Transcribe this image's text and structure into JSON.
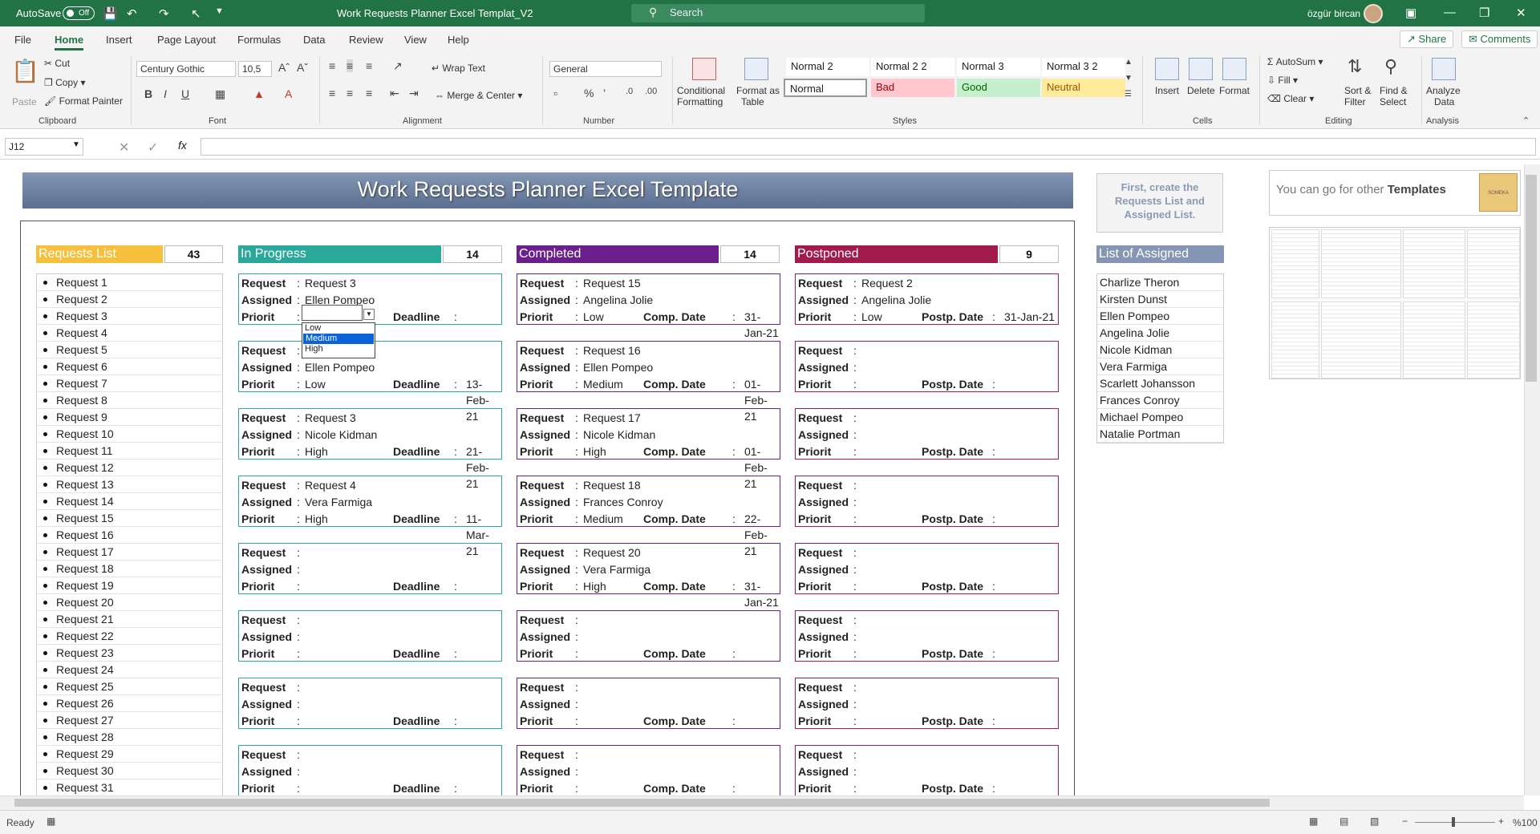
{
  "titlebar": {
    "autosave": "AutoSave",
    "autosave_state": "Off",
    "doc_title": "Work Requests Planner Excel Templat_V2",
    "search_placeholder": "Search",
    "user": "özgür bircan"
  },
  "tabs": [
    "File",
    "Home",
    "Insert",
    "Page Layout",
    "Formulas",
    "Data",
    "Review",
    "View",
    "Help"
  ],
  "share": "Share",
  "comments": "Comments",
  "ribbon": {
    "clipboard": {
      "paste": "Paste",
      "cut": "Cut",
      "copy": "Copy",
      "format_painter": "Format Painter",
      "label": "Clipboard"
    },
    "font": {
      "name": "Century Gothic",
      "size": "10,5",
      "label": "Font"
    },
    "alignment": {
      "wrap": "Wrap Text",
      "merge": "Merge & Center",
      "label": "Alignment"
    },
    "number": {
      "format": "General",
      "label": "Number"
    },
    "styles": {
      "conditional": "Conditional",
      "conditional2": "Formatting",
      "format_table": "Format as",
      "format_table2": "Table",
      "cells": [
        {
          "name": "Normal 2",
          "bg": "#ffffff",
          "fg": "#222222"
        },
        {
          "name": "Normal 2 2",
          "bg": "#ffffff",
          "fg": "#222222"
        },
        {
          "name": "Normal 3",
          "bg": "#ffffff",
          "fg": "#222222"
        },
        {
          "name": "Normal 3 2",
          "bg": "#ffffff",
          "fg": "#222222"
        },
        {
          "name": "Normal",
          "bg": "#ffffff",
          "fg": "#222222"
        },
        {
          "name": "Bad",
          "bg": "#ffc7ce",
          "fg": "#9c0006"
        },
        {
          "name": "Good",
          "bg": "#c6efce",
          "fg": "#006100"
        },
        {
          "name": "Neutral",
          "bg": "#ffeb9c",
          "fg": "#9c5700"
        }
      ],
      "label": "Styles"
    },
    "cells": {
      "insert": "Insert",
      "delete": "Delete",
      "format": "Format",
      "label": "Cells"
    },
    "editing": {
      "autosum": "AutoSum",
      "fill": "Fill",
      "clear": "Clear",
      "sort": "Sort &",
      "sort2": "Filter",
      "find": "Find &",
      "find2": "Select",
      "label": "Editing"
    },
    "analysis": {
      "analyze": "Analyze",
      "analyze2": "Data",
      "label": "Analysis"
    }
  },
  "formula": {
    "namebox": "J12",
    "fx": "fx"
  },
  "sheet": {
    "title": "Work Requests Planner Excel Template",
    "requests_list": {
      "label": "Requests List",
      "count": "43",
      "items": [
        "Request 1",
        "Request 2",
        "Request 3",
        "Request 4",
        "Request 5",
        "Request 6",
        "Request 7",
        "Request 8",
        "Request 9",
        "Request 10",
        "Request 11",
        "Request 12",
        "Request 13",
        "Request 14",
        "Request 15",
        "Request 16",
        "Request 17",
        "Request 18",
        "Request 19",
        "Request 20",
        "Request 21",
        "Request 22",
        "Request 23",
        "Request 24",
        "Request 25",
        "Request 26",
        "Request 27",
        "Request 28",
        "Request 29",
        "Request 30",
        "Request 31"
      ]
    },
    "labels": {
      "request": "Request",
      "assigned": "Assigned",
      "priority": "Priorit",
      "colon": ":",
      "deadline": "Deadline",
      "comp_date": "Comp. Date",
      "postp_date": "Postp. Date"
    },
    "in_progress": {
      "label": "In Progress",
      "count": "14",
      "color": "#2aa89a",
      "border": "#2aa89a",
      "cards": [
        {
          "request": "Request 3",
          "assigned": "Ellen Pompeo",
          "priority": "",
          "date": ""
        },
        {
          "request": "",
          "assigned": "Ellen Pompeo",
          "priority": "Low",
          "date": "13-Feb-21"
        },
        {
          "request": "Request 3",
          "assigned": "Nicole Kidman",
          "priority": "High",
          "date": "21-Feb-21"
        },
        {
          "request": "Request 4",
          "assigned": "Vera Farmiga",
          "priority": "High",
          "date": "11-Mar-21"
        },
        {
          "request": "",
          "assigned": "",
          "priority": "",
          "date": ""
        },
        {
          "request": "",
          "assigned": "",
          "priority": "",
          "date": ""
        },
        {
          "request": "",
          "assigned": "",
          "priority": "",
          "date": ""
        },
        {
          "request": "",
          "assigned": "",
          "priority": "",
          "date": ""
        }
      ]
    },
    "completed": {
      "label": "Completed",
      "count": "14",
      "color": "#6b1f8a",
      "border": "#6b1f8a",
      "cards": [
        {
          "request": "Request 15",
          "assigned": "Angelina Jolie",
          "priority": "Low",
          "date": "31-Jan-21"
        },
        {
          "request": "Request 16",
          "assigned": "Ellen Pompeo",
          "priority": "Medium",
          "date": "01-Feb-21"
        },
        {
          "request": "Request 17",
          "assigned": "Nicole Kidman",
          "priority": "High",
          "date": "01-Feb-21"
        },
        {
          "request": "Request 18",
          "assigned": "Frances Conroy",
          "priority": "Medium",
          "date": "22-Feb-21"
        },
        {
          "request": "Request 20",
          "assigned": "Vera Farmiga",
          "priority": "High",
          "date": "31-Jan-21"
        },
        {
          "request": "",
          "assigned": "",
          "priority": "",
          "date": ""
        },
        {
          "request": "",
          "assigned": "",
          "priority": "",
          "date": ""
        },
        {
          "request": "",
          "assigned": "",
          "priority": "",
          "date": ""
        }
      ]
    },
    "postponed": {
      "label": "Postponed",
      "count": "9",
      "color": "#a11c4c",
      "border": "#a11c4c",
      "cards": [
        {
          "request": "Request 2",
          "assigned": "Angelina Jolie",
          "priority": "Low",
          "date": "31-Jan-21"
        },
        {
          "request": "",
          "assigned": "",
          "priority": "",
          "date": ""
        },
        {
          "request": "",
          "assigned": "",
          "priority": "",
          "date": ""
        },
        {
          "request": "",
          "assigned": "",
          "priority": "",
          "date": ""
        },
        {
          "request": "",
          "assigned": "",
          "priority": "",
          "date": ""
        },
        {
          "request": "",
          "assigned": "",
          "priority": "",
          "date": ""
        },
        {
          "request": "",
          "assigned": "",
          "priority": "",
          "date": ""
        },
        {
          "request": "",
          "assigned": "",
          "priority": "",
          "date": ""
        }
      ]
    },
    "dropdown": {
      "options": [
        "Low",
        "Medium",
        "High"
      ],
      "selected": "Medium"
    },
    "hint": "First, create the Requests List and Assigned List.",
    "assigned_list": {
      "label": "List of Assigned",
      "items": [
        "Charlize Theron",
        "Kirsten Dunst",
        "Ellen Pompeo",
        "Angelina Jolie",
        "Nicole Kidman",
        "Vera Farmiga",
        "Scarlett Johansson",
        "Frances Conroy",
        "Michael Pompeo",
        "Natalie Portman"
      ]
    },
    "promo": {
      "text": "You can go for other",
      "bold": "Templates"
    }
  },
  "status": {
    "ready": "Ready",
    "zoom": "%100"
  },
  "colors": {
    "excel_green": "#217346",
    "requests_bar": "#f6bf3c",
    "assigned_bar": "#8496b3"
  }
}
